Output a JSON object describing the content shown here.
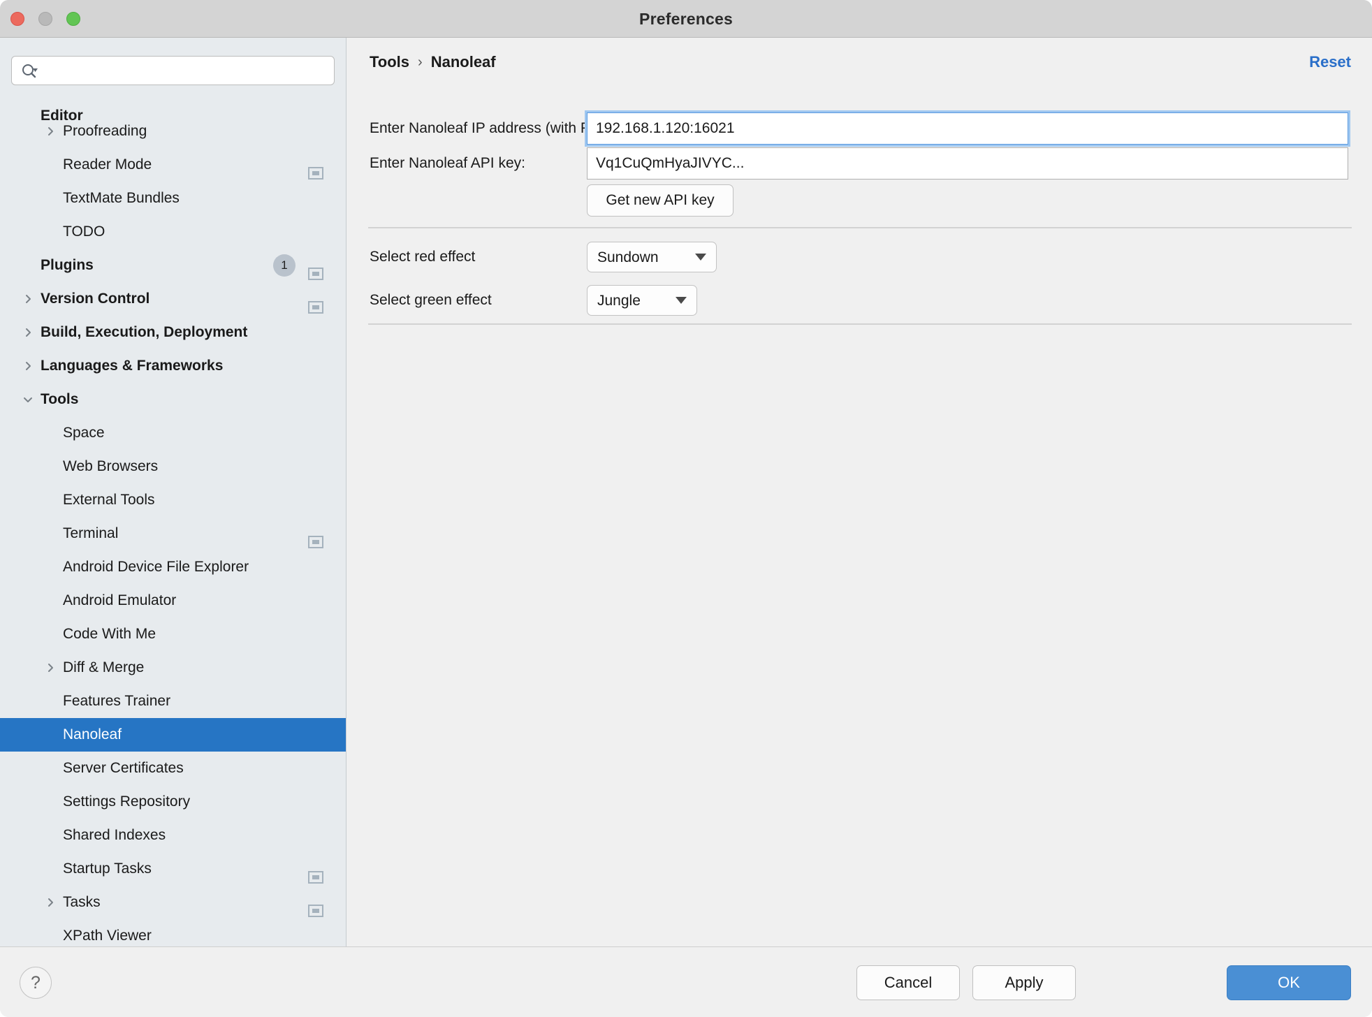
{
  "window": {
    "title": "Preferences",
    "traffic_lights": [
      "close-button",
      "minimize-button",
      "maximize-button"
    ]
  },
  "sidebar": {
    "search": {
      "value": "",
      "placeholder": ""
    },
    "items": [
      {
        "label": "Editor",
        "depth": 1,
        "bold": true,
        "arrow": "",
        "badge": "",
        "cfg": false,
        "selected": false,
        "overlap": false
      },
      {
        "label": "Proofreading",
        "depth": 2,
        "bold": false,
        "arrow": "right",
        "badge": "",
        "cfg": false,
        "selected": false,
        "overlap": true
      },
      {
        "label": "Reader Mode",
        "depth": 2,
        "bold": false,
        "arrow": "",
        "badge": "",
        "cfg": true,
        "selected": false,
        "overlap": false
      },
      {
        "label": "TextMate Bundles",
        "depth": 2,
        "bold": false,
        "arrow": "",
        "badge": "",
        "cfg": false,
        "selected": false,
        "overlap": false
      },
      {
        "label": "TODO",
        "depth": 2,
        "bold": false,
        "arrow": "",
        "badge": "",
        "cfg": false,
        "selected": false,
        "overlap": false
      },
      {
        "label": "Plugins",
        "depth": 1,
        "bold": true,
        "arrow": "",
        "badge": "1",
        "cfg": true,
        "selected": false,
        "overlap": false
      },
      {
        "label": "Version Control",
        "depth": 1,
        "bold": true,
        "arrow": "right",
        "badge": "",
        "cfg": true,
        "selected": false,
        "overlap": false
      },
      {
        "label": "Build, Execution, Deployment",
        "depth": 1,
        "bold": true,
        "arrow": "right",
        "badge": "",
        "cfg": false,
        "selected": false,
        "overlap": false
      },
      {
        "label": "Languages & Frameworks",
        "depth": 1,
        "bold": true,
        "arrow": "right",
        "badge": "",
        "cfg": false,
        "selected": false,
        "overlap": false
      },
      {
        "label": "Tools",
        "depth": 1,
        "bold": true,
        "arrow": "down",
        "badge": "",
        "cfg": false,
        "selected": false,
        "overlap": false
      },
      {
        "label": "Space",
        "depth": 2,
        "bold": false,
        "arrow": "",
        "badge": "",
        "cfg": false,
        "selected": false,
        "overlap": false
      },
      {
        "label": "Web Browsers",
        "depth": 2,
        "bold": false,
        "arrow": "",
        "badge": "",
        "cfg": false,
        "selected": false,
        "overlap": false
      },
      {
        "label": "External Tools",
        "depth": 2,
        "bold": false,
        "arrow": "",
        "badge": "",
        "cfg": false,
        "selected": false,
        "overlap": false
      },
      {
        "label": "Terminal",
        "depth": 2,
        "bold": false,
        "arrow": "",
        "badge": "",
        "cfg": true,
        "selected": false,
        "overlap": false
      },
      {
        "label": "Android Device File Explorer",
        "depth": 2,
        "bold": false,
        "arrow": "",
        "badge": "",
        "cfg": false,
        "selected": false,
        "overlap": false
      },
      {
        "label": "Android Emulator",
        "depth": 2,
        "bold": false,
        "arrow": "",
        "badge": "",
        "cfg": false,
        "selected": false,
        "overlap": false
      },
      {
        "label": "Code With Me",
        "depth": 2,
        "bold": false,
        "arrow": "",
        "badge": "",
        "cfg": false,
        "selected": false,
        "overlap": false
      },
      {
        "label": "Diff & Merge",
        "depth": 2,
        "bold": false,
        "arrow": "right",
        "badge": "",
        "cfg": false,
        "selected": false,
        "overlap": false
      },
      {
        "label": "Features Trainer",
        "depth": 2,
        "bold": false,
        "arrow": "",
        "badge": "",
        "cfg": false,
        "selected": false,
        "overlap": false
      },
      {
        "label": "Nanoleaf",
        "depth": 2,
        "bold": false,
        "arrow": "",
        "badge": "",
        "cfg": false,
        "selected": true,
        "overlap": false
      },
      {
        "label": "Server Certificates",
        "depth": 2,
        "bold": false,
        "arrow": "",
        "badge": "",
        "cfg": false,
        "selected": false,
        "overlap": false
      },
      {
        "label": "Settings Repository",
        "depth": 2,
        "bold": false,
        "arrow": "",
        "badge": "",
        "cfg": false,
        "selected": false,
        "overlap": false
      },
      {
        "label": "Shared Indexes",
        "depth": 2,
        "bold": false,
        "arrow": "",
        "badge": "",
        "cfg": false,
        "selected": false,
        "overlap": false
      },
      {
        "label": "Startup Tasks",
        "depth": 2,
        "bold": false,
        "arrow": "",
        "badge": "",
        "cfg": true,
        "selected": false,
        "overlap": false
      },
      {
        "label": "Tasks",
        "depth": 2,
        "bold": false,
        "arrow": "right",
        "badge": "",
        "cfg": true,
        "selected": false,
        "overlap": false
      },
      {
        "label": "XPath Viewer",
        "depth": 2,
        "bold": false,
        "arrow": "",
        "badge": "",
        "cfg": false,
        "selected": false,
        "overlap": false
      }
    ]
  },
  "main": {
    "breadcrumb": {
      "parent": "Tools",
      "separator": "›",
      "current": "Nanoleaf"
    },
    "reset_label": "Reset",
    "ip_field": {
      "label": "Enter Nanoleaf IP address (with PORT):",
      "value": "192.168.1.120:16021",
      "placeholder": ""
    },
    "api_field": {
      "label": "Enter Nanoleaf API key:",
      "value": "Vq1CuQmHyaJIVYC...",
      "placeholder": ""
    },
    "get_key_button": "Get new API key",
    "red_effect": {
      "label": "Select red effect",
      "value": "Sundown"
    },
    "green_effect": {
      "label": "Select green effect",
      "value": "Jungle"
    }
  },
  "footer": {
    "help_label": "?",
    "cancel_label": "Cancel",
    "apply_label": "Apply",
    "ok_label": "OK"
  },
  "colors": {
    "selection_blue": "#2675c4",
    "link_blue": "#2a6fc9",
    "primary_button": "#4a8fd4",
    "focus_ring": "#9fc7f0",
    "sidebar_bg": "#e7ebee",
    "panel_bg": "#f0f0f0"
  }
}
